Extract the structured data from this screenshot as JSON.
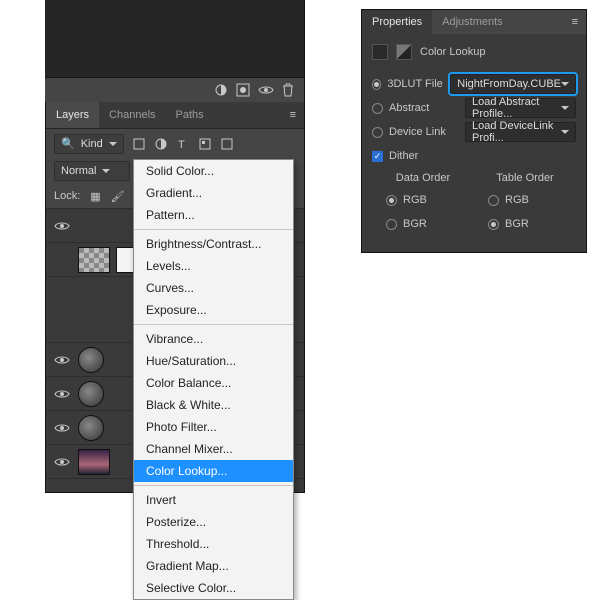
{
  "layers_panel": {
    "tabs": [
      "Layers",
      "Channels",
      "Paths"
    ],
    "filter": {
      "search": "Kind"
    },
    "blend_mode": "Normal",
    "lock_label": "Lock:"
  },
  "menu": {
    "groups": [
      [
        "Solid Color...",
        "Gradient...",
        "Pattern..."
      ],
      [
        "Brightness/Contrast...",
        "Levels...",
        "Curves...",
        "Exposure..."
      ],
      [
        "Vibrance...",
        "Hue/Saturation...",
        "Color Balance...",
        "Black & White...",
        "Photo Filter...",
        "Channel Mixer...",
        "Color Lookup..."
      ],
      [
        "Invert",
        "Posterize...",
        "Threshold...",
        "Gradient Map...",
        "Selective Color..."
      ]
    ],
    "selected": "Color Lookup..."
  },
  "properties": {
    "tabs": [
      "Properties",
      "Adjustments"
    ],
    "title": "Color Lookup",
    "rows": {
      "file_label": "3DLUT File",
      "file_value": "NightFromDay.CUBE",
      "abstract_label": "Abstract",
      "abstract_value": "Load Abstract Profile...",
      "device_label": "Device Link",
      "device_value": "Load  DeviceLink  Profi...",
      "dither_label": "Dither"
    },
    "order": {
      "data_hdr": "Data Order",
      "table_hdr": "Table Order",
      "rgb": "RGB",
      "bgr": "BGR"
    }
  }
}
